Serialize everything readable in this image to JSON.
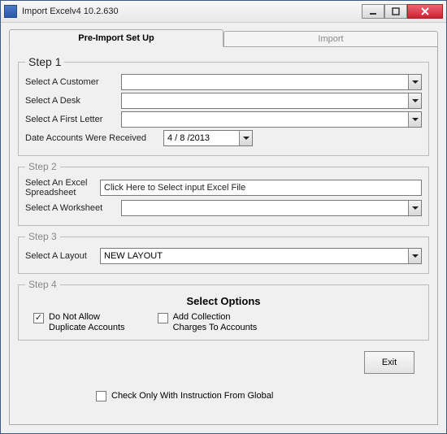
{
  "window": {
    "title": "Import Excelv4 10.2.630"
  },
  "tabs": {
    "preimport": "Pre-Import Set Up",
    "import": "Import"
  },
  "step1": {
    "legend": "Step 1",
    "customer_label": "Select A Customer",
    "customer_value": "",
    "desk_label": "Select A Desk",
    "desk_value": "",
    "letter_label": "Select A First Letter",
    "letter_value": "",
    "date_label": "Date Accounts Were Received",
    "date_value": " 4 / 8 /2013"
  },
  "step2": {
    "legend": "Step 2",
    "excel_label": "Select An Excel Spreadsheet",
    "excel_value": "Click Here to Select input Excel File",
    "worksheet_label": "Select A Worksheet",
    "worksheet_value": ""
  },
  "step3": {
    "legend": "Step 3",
    "layout_label": "Select A Layout",
    "layout_value": "NEW LAYOUT"
  },
  "step4": {
    "legend": "Step 4",
    "options_title": "Select Options",
    "no_dup_label": "Do Not Allow\nDuplicate Accounts",
    "no_dup_checked": true,
    "add_charges_label": "Add Collection\nCharges To Accounts",
    "add_charges_checked": false
  },
  "exit_label": "Exit",
  "global_check_label": "Check Only With Instruction From Global",
  "global_check_checked": false
}
